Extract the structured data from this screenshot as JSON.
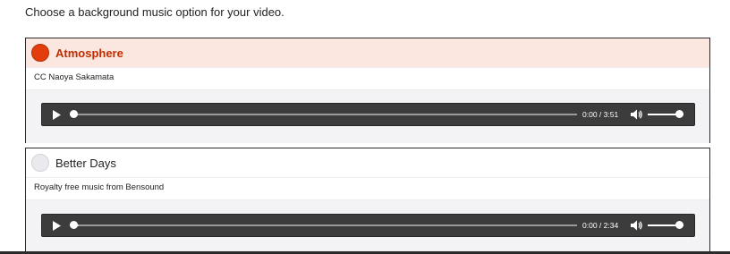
{
  "intro_text": "Choose a background music option for your video.",
  "options": [
    {
      "title": "Atmosphere",
      "credit": "CC Naoya Sakamata",
      "selected": true,
      "player": {
        "current_time": "0:00",
        "duration": "3:51",
        "time_display": "0:00 / 3:51",
        "progress": 0,
        "volume": 1
      }
    },
    {
      "title": "Better Days",
      "credit": "Royalty free music from Bensound",
      "selected": false,
      "player": {
        "current_time": "0:00",
        "duration": "2:34",
        "time_display": "0:00 / 2:34",
        "progress": 0,
        "volume": 1
      }
    }
  ],
  "icons": {
    "play": "play-icon",
    "volume": "volume-icon"
  },
  "colors": {
    "selected_accent": "#e23d0a",
    "selected_header_bg": "#fbe7df",
    "player_bg": "#3c3c3c"
  }
}
